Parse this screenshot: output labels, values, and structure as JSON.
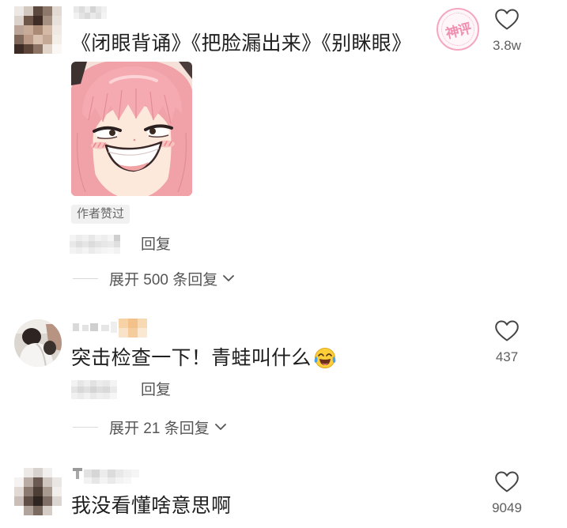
{
  "comments": [
    {
      "text": "《闭眼背诵》《把脸漏出来》《别眯眼》",
      "stamp": "神评",
      "like_count": "3.8w",
      "author_badge": "作者赞过",
      "reply_label": "回复",
      "expand_label": "展开 500 条回复"
    },
    {
      "text": "突击检查一下！青蛙叫什么",
      "emoji": "face-with-tears-of-joy",
      "like_count": "437",
      "reply_label": "回复",
      "expand_label": "展开 21 条回复"
    },
    {
      "text": "我没看懂啥意思啊",
      "like_count": "9049"
    }
  ],
  "icons": {
    "like": "heart-outline-icon",
    "expand": "chevron-down-icon",
    "stamp": "top-comment-stamp"
  },
  "colors": {
    "text_primary": "#1f1f1f",
    "text_secondary": "#5c5c5c",
    "stamp_pink": "#f1a2bd",
    "badge_background": "#f1f1f1"
  }
}
